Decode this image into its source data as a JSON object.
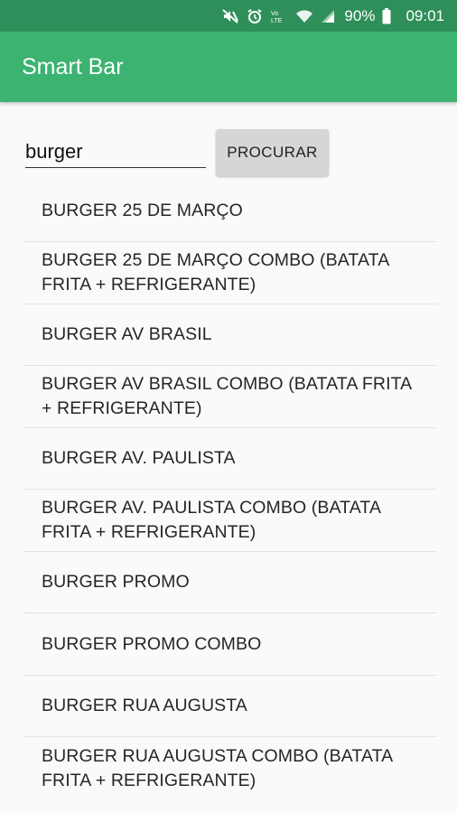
{
  "status_bar": {
    "battery": "90%",
    "time": "09:01",
    "icons": [
      "mute-icon",
      "alarm-icon",
      "volte-icon",
      "wifi-icon",
      "signal-icon",
      "battery-icon"
    ]
  },
  "app_bar": {
    "title": "Smart Bar"
  },
  "search": {
    "value": "burger",
    "button_label": "PROCURAR"
  },
  "results": [
    {
      "label": "BURGER 25 DE MARÇO"
    },
    {
      "label": "BURGER 25 DE MARÇO COMBO (BATATA FRITA + REFRIGERANTE)"
    },
    {
      "label": "BURGER AV BRASIL"
    },
    {
      "label": "BURGER AV BRASIL COMBO (BATATA FRITA + REFRIGERANTE)"
    },
    {
      "label": "BURGER AV. PAULISTA"
    },
    {
      "label": "BURGER AV. PAULISTA COMBO (BATATA FRITA + REFRIGERANTE)"
    },
    {
      "label": "BURGER PROMO"
    },
    {
      "label": "BURGER PROMO COMBO"
    },
    {
      "label": "BURGER RUA AUGUSTA"
    },
    {
      "label": "BURGER RUA AUGUSTA COMBO (BATATA FRITA + REFRIGERANTE)"
    }
  ],
  "colors": {
    "status_bar": "#2f8f5b",
    "app_bar": "#3cb371",
    "background": "#fafafa",
    "button": "#d6d6d6"
  }
}
